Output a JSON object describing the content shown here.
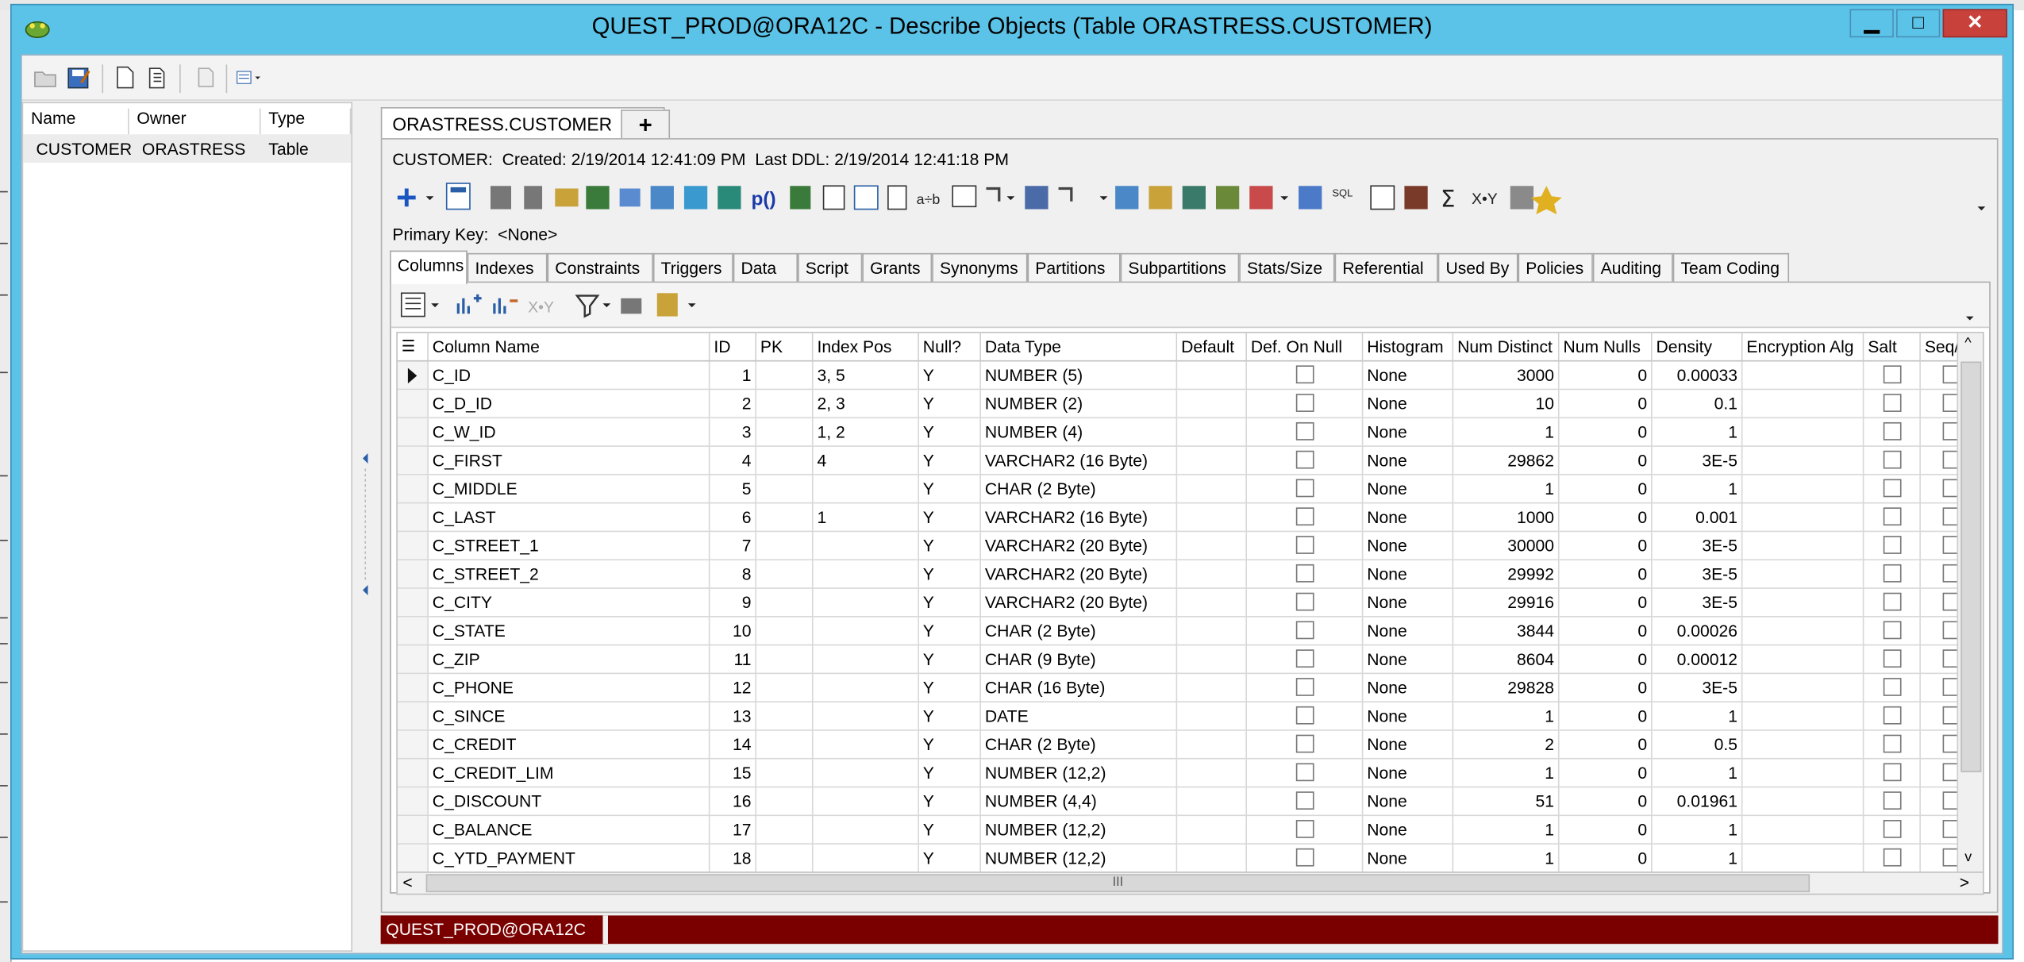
{
  "window": {
    "title": "QUEST_PROD@ORA12C - Describe Objects (Table ORASTRESS.CUSTOMER)",
    "controls": {
      "minimize": "▁",
      "maximize": "□",
      "close": "✕"
    }
  },
  "main_toolbar": {
    "icons": [
      "open-folder-icon",
      "save-icon",
      "new-document-icon",
      "copy-document-icon",
      "print-icon",
      "view-options-icon"
    ]
  },
  "object_list": {
    "columns": [
      "Name",
      "Owner",
      "Type"
    ],
    "rows": [
      {
        "name": "CUSTOMER",
        "owner": "ORASTRESS",
        "type": "Table"
      }
    ]
  },
  "document_tab": {
    "label": "ORASTRESS.CUSTOMER",
    "add": "+"
  },
  "info": {
    "object": "CUSTOMER:",
    "created_label": "Created:",
    "created": "2/19/2014 12:41:09 PM",
    "last_ddl_label": "Last DDL:",
    "last_ddl": "2/19/2014 12:41:18 PM"
  },
  "primary_key": {
    "label": "Primary Key:",
    "value": "<None>"
  },
  "tabs": [
    "Columns",
    "Indexes",
    "Constraints",
    "Triggers",
    "Data",
    "Script",
    "Grants",
    "Synonyms",
    "Partitions",
    "Subpartitions",
    "Stats/Size",
    "Referential",
    "Used By",
    "Policies",
    "Auditing",
    "Team Coding"
  ],
  "active_tab": "Columns",
  "grid": {
    "headers": [
      "Column Name",
      "ID",
      "PK",
      "Index Pos",
      "Null?",
      "Data Type",
      "Default",
      "Def. On Null",
      "Histogram",
      "Num Distinct",
      "Num Nulls",
      "Density",
      "Encryption Alg",
      "Salt",
      "Seq/Tri"
    ],
    "rows": [
      {
        "name": "C_ID",
        "id": "1",
        "pk": "",
        "index_pos": "3, 5",
        "null": "Y",
        "type": "NUMBER (5)",
        "default": "",
        "histogram": "None",
        "distinct": "3000",
        "nulls": "0",
        "density": "0.00033"
      },
      {
        "name": "C_D_ID",
        "id": "2",
        "pk": "",
        "index_pos": "2, 3",
        "null": "Y",
        "type": "NUMBER (2)",
        "default": "",
        "histogram": "None",
        "distinct": "10",
        "nulls": "0",
        "density": "0.1"
      },
      {
        "name": "C_W_ID",
        "id": "3",
        "pk": "",
        "index_pos": "1, 2",
        "null": "Y",
        "type": "NUMBER (4)",
        "default": "",
        "histogram": "None",
        "distinct": "1",
        "nulls": "0",
        "density": "1"
      },
      {
        "name": "C_FIRST",
        "id": "4",
        "pk": "",
        "index_pos": "4",
        "null": "Y",
        "type": "VARCHAR2 (16 Byte)",
        "default": "",
        "histogram": "None",
        "distinct": "29862",
        "nulls": "0",
        "density": "3E-5"
      },
      {
        "name": "C_MIDDLE",
        "id": "5",
        "pk": "",
        "index_pos": "",
        "null": "Y",
        "type": "CHAR (2 Byte)",
        "default": "",
        "histogram": "None",
        "distinct": "1",
        "nulls": "0",
        "density": "1"
      },
      {
        "name": "C_LAST",
        "id": "6",
        "pk": "",
        "index_pos": "1",
        "null": "Y",
        "type": "VARCHAR2 (16 Byte)",
        "default": "",
        "histogram": "None",
        "distinct": "1000",
        "nulls": "0",
        "density": "0.001"
      },
      {
        "name": "C_STREET_1",
        "id": "7",
        "pk": "",
        "index_pos": "",
        "null": "Y",
        "type": "VARCHAR2 (20 Byte)",
        "default": "",
        "histogram": "None",
        "distinct": "30000",
        "nulls": "0",
        "density": "3E-5"
      },
      {
        "name": "C_STREET_2",
        "id": "8",
        "pk": "",
        "index_pos": "",
        "null": "Y",
        "type": "VARCHAR2 (20 Byte)",
        "default": "",
        "histogram": "None",
        "distinct": "29992",
        "nulls": "0",
        "density": "3E-5"
      },
      {
        "name": "C_CITY",
        "id": "9",
        "pk": "",
        "index_pos": "",
        "null": "Y",
        "type": "VARCHAR2 (20 Byte)",
        "default": "",
        "histogram": "None",
        "distinct": "29916",
        "nulls": "0",
        "density": "3E-5"
      },
      {
        "name": "C_STATE",
        "id": "10",
        "pk": "",
        "index_pos": "",
        "null": "Y",
        "type": "CHAR (2 Byte)",
        "default": "",
        "histogram": "None",
        "distinct": "3844",
        "nulls": "0",
        "density": "0.00026"
      },
      {
        "name": "C_ZIP",
        "id": "11",
        "pk": "",
        "index_pos": "",
        "null": "Y",
        "type": "CHAR (9 Byte)",
        "default": "",
        "histogram": "None",
        "distinct": "8604",
        "nulls": "0",
        "density": "0.00012"
      },
      {
        "name": "C_PHONE",
        "id": "12",
        "pk": "",
        "index_pos": "",
        "null": "Y",
        "type": "CHAR (16 Byte)",
        "default": "",
        "histogram": "None",
        "distinct": "29828",
        "nulls": "0",
        "density": "3E-5"
      },
      {
        "name": "C_SINCE",
        "id": "13",
        "pk": "",
        "index_pos": "",
        "null": "Y",
        "type": "DATE",
        "default": "",
        "histogram": "None",
        "distinct": "1",
        "nulls": "0",
        "density": "1"
      },
      {
        "name": "C_CREDIT",
        "id": "14",
        "pk": "",
        "index_pos": "",
        "null": "Y",
        "type": "CHAR (2 Byte)",
        "default": "",
        "histogram": "None",
        "distinct": "2",
        "nulls": "0",
        "density": "0.5"
      },
      {
        "name": "C_CREDIT_LIM",
        "id": "15",
        "pk": "",
        "index_pos": "",
        "null": "Y",
        "type": "NUMBER (12,2)",
        "default": "",
        "histogram": "None",
        "distinct": "1",
        "nulls": "0",
        "density": "1"
      },
      {
        "name": "C_DISCOUNT",
        "id": "16",
        "pk": "",
        "index_pos": "",
        "null": "Y",
        "type": "NUMBER (4,4)",
        "default": "",
        "histogram": "None",
        "distinct": "51",
        "nulls": "0",
        "density": "0.01961"
      },
      {
        "name": "C_BALANCE",
        "id": "17",
        "pk": "",
        "index_pos": "",
        "null": "Y",
        "type": "NUMBER (12,2)",
        "default": "",
        "histogram": "None",
        "distinct": "1",
        "nulls": "0",
        "density": "1"
      },
      {
        "name": "C_YTD_PAYMENT",
        "id": "18",
        "pk": "",
        "index_pos": "",
        "null": "Y",
        "type": "NUMBER (12,2)",
        "default": "",
        "histogram": "None",
        "distinct": "1",
        "nulls": "0",
        "density": "1"
      }
    ]
  },
  "scroll": {
    "left": "<",
    "right": ">",
    "up": "^",
    "down": "v",
    "grip": "III"
  },
  "status": {
    "connection": "QUEST_PROD@ORA12C"
  },
  "colors": {
    "titlebar": "#5bc3e8",
    "status": "#7a0000",
    "close": "#c9413b"
  }
}
